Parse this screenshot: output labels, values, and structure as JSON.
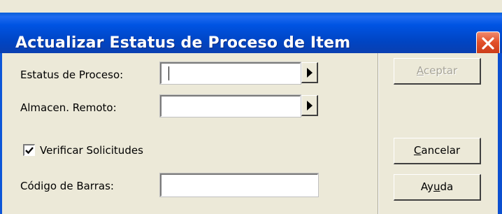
{
  "window": {
    "title": "Actualizar Estatus de Proceso de Item"
  },
  "fields": {
    "status_label": "Estatus de Proceso:",
    "status_value": "",
    "remote_label": "Almacen. Remoto:",
    "remote_value": "",
    "verify_label": "Verificar Solicitudes",
    "verify_checked": true,
    "barcode_label": "Código de Barras:",
    "barcode_value": ""
  },
  "buttons": {
    "accept": {
      "prefix": "",
      "accel": "A",
      "rest": "ceptar",
      "enabled": false
    },
    "cancel": {
      "prefix": "",
      "accel": "C",
      "rest": "ancelar",
      "enabled": true
    },
    "help": {
      "prefix": "Ay",
      "accel": "u",
      "rest": "da",
      "enabled": true
    }
  },
  "icons": {
    "close": "close-icon",
    "arrow": "triangle-right-icon",
    "check": "checkmark-icon"
  },
  "colors": {
    "titlebar": "#0054e3",
    "close": "#e2502a",
    "face": "#ece9d8"
  }
}
